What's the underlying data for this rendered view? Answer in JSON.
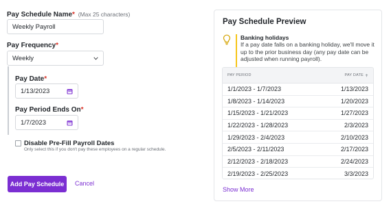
{
  "form": {
    "schedule_name": {
      "label": "Pay Schedule Name",
      "required_mark": "*",
      "hint": "(Max 25 characters)",
      "value": "Weekly Payroll"
    },
    "pay_frequency": {
      "label": "Pay Frequency",
      "required_mark": "*",
      "value": "Weekly"
    },
    "pay_date": {
      "label": "Pay Date",
      "required_mark": "*",
      "value": "1/13/2023"
    },
    "period_ends_on": {
      "label": "Pay Period Ends On",
      "required_mark": "*",
      "value": "1/7/2023"
    },
    "disable_prefill": {
      "label": "Disable Pre-Fill Payroll Dates",
      "hint": "Only select this if you don't pay these employees on a regular schedule.",
      "checked": false
    },
    "primary_button": "Add Pay Schedule",
    "cancel_link": "Cancel"
  },
  "preview": {
    "title": "Pay Schedule Preview",
    "notice": {
      "title": "Banking holidays",
      "body": "If a pay date falls on a banking holiday, we'll move it up to the prior business day (any pay date can be adjusted when running payroll)."
    },
    "table": {
      "headers": [
        "PAY PERIOD",
        "PAY DATE"
      ],
      "rows": [
        [
          "1/1/2023 - 1/7/2023",
          "1/13/2023"
        ],
        [
          "1/8/2023 - 1/14/2023",
          "1/20/2023"
        ],
        [
          "1/15/2023 - 1/21/2023",
          "1/27/2023"
        ],
        [
          "1/22/2023 - 1/28/2023",
          "2/3/2023"
        ],
        [
          "1/29/2023 - 2/4/2023",
          "2/10/2023"
        ],
        [
          "2/5/2023 - 2/11/2023",
          "2/17/2023"
        ],
        [
          "2/12/2023 - 2/18/2023",
          "2/24/2023"
        ],
        [
          "2/19/2023 - 2/25/2023",
          "3/3/2023"
        ]
      ]
    },
    "show_more": "Show More"
  },
  "colors": {
    "accent": "#7b2ed2",
    "required": "#d93025",
    "notice_bar": "#f5c518",
    "calendar_icon": "#7b2ed2"
  },
  "icons": {
    "frequency_select": "chevron-down-icon",
    "date_picker": "calendar-icon",
    "notice": "lightbulb-icon",
    "sort": "sort-arrow-icon"
  }
}
